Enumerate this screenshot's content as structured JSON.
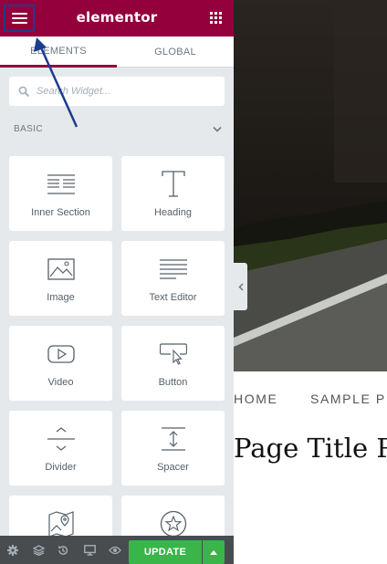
{
  "topbar": {
    "logo": "elementor",
    "menu_icon": "hamburger-menu-icon",
    "apps_icon": "grid-icon",
    "bg_color": "#93003c"
  },
  "tabs": [
    {
      "label": "ELEMENTS",
      "active": true
    },
    {
      "label": "GLOBAL",
      "active": false
    }
  ],
  "search": {
    "placeholder": "Search Widget...",
    "icon": "search-icon"
  },
  "category": {
    "label": "BASIC",
    "expanded": true,
    "icon": "chevron-down-icon"
  },
  "widgets": [
    {
      "label": "Inner Section",
      "icon": "inner-section-icon"
    },
    {
      "label": "Heading",
      "icon": "heading-icon"
    },
    {
      "label": "Image",
      "icon": "image-icon"
    },
    {
      "label": "Text Editor",
      "icon": "text-editor-icon"
    },
    {
      "label": "Video",
      "icon": "video-icon"
    },
    {
      "label": "Button",
      "icon": "button-icon"
    },
    {
      "label": "Divider",
      "icon": "divider-icon"
    },
    {
      "label": "Spacer",
      "icon": "spacer-icon"
    },
    {
      "label": "",
      "icon": "google-maps-icon"
    },
    {
      "label": "",
      "icon": "star-icon"
    }
  ],
  "footer": {
    "icons": [
      "settings-icon",
      "navigator-icon",
      "history-icon",
      "responsive-mode-icon",
      "preview-icon"
    ],
    "update_label": "UPDATE",
    "update_color": "#39b54a"
  },
  "preview": {
    "nav": [
      "HOME",
      "SAMPLE P"
    ],
    "page_title": "Page Title P"
  }
}
